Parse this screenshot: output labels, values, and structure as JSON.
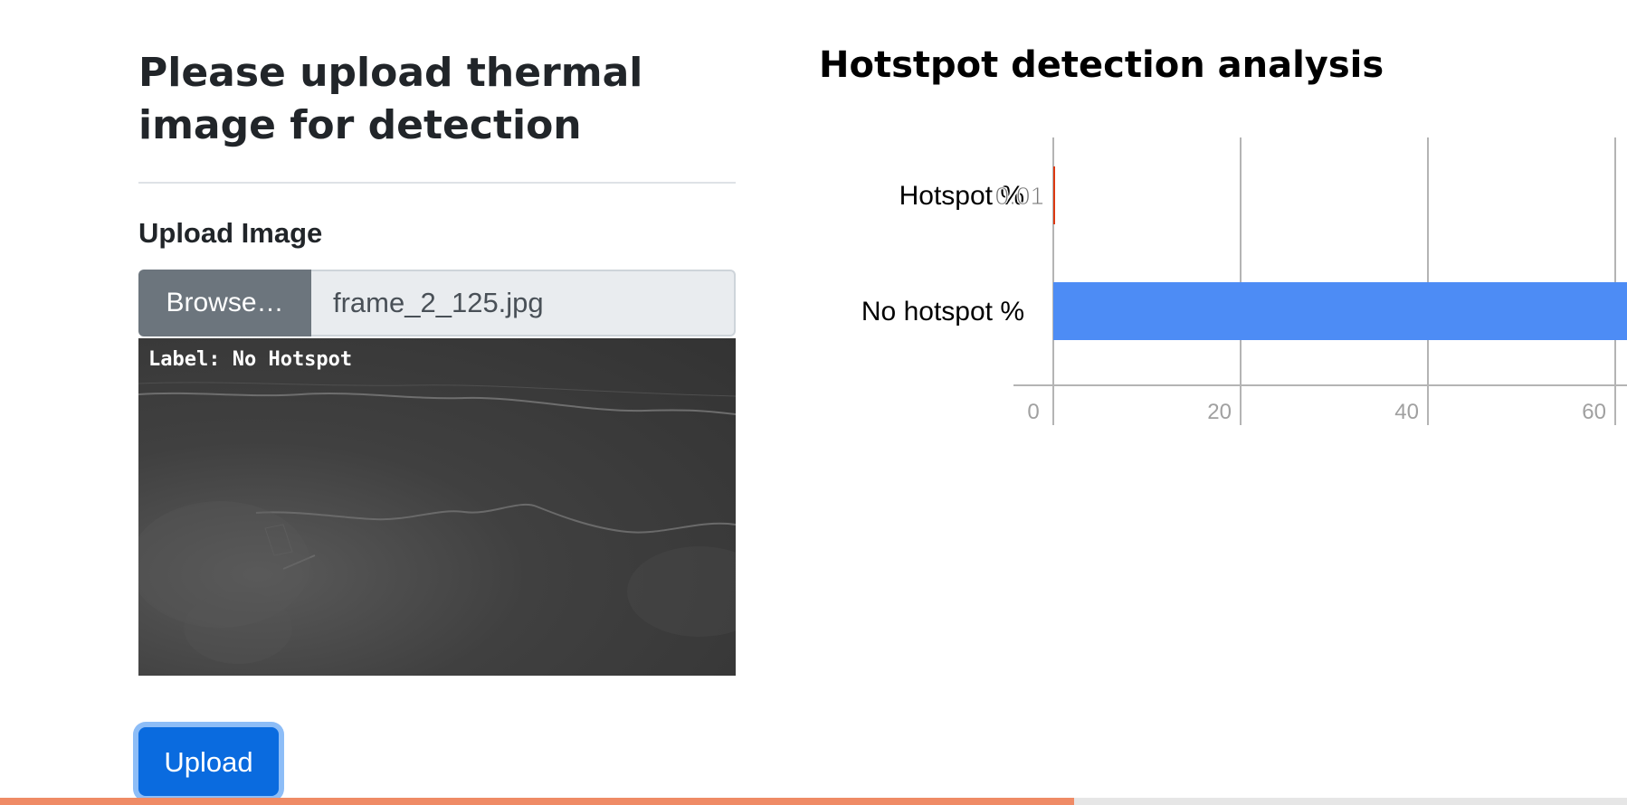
{
  "left_panel": {
    "title": "Please upload thermal image for detection",
    "upload_label": "Upload Image",
    "browse_label": "Browse…",
    "file_name": "frame_2_125.jpg",
    "preview_label": "Label: No Hotspot",
    "upload_button": "Upload"
  },
  "right_panel": {
    "title": "Hotstpot detection analysis"
  },
  "chart_data": {
    "type": "bar",
    "orientation": "horizontal",
    "categories": [
      "Hotspot %",
      "No hotspot %"
    ],
    "values": [
      0.01,
      99.99
    ],
    "data_labels": [
      "0.01",
      ""
    ],
    "bar_colors": [
      "#dc3912",
      "#4d8cf5"
    ],
    "xticks": [
      "0",
      "20",
      "40",
      "60"
    ],
    "xlim": [
      0,
      100
    ],
    "grid": true
  },
  "progress": {
    "value": 0.66,
    "color": "#ef8b66"
  }
}
